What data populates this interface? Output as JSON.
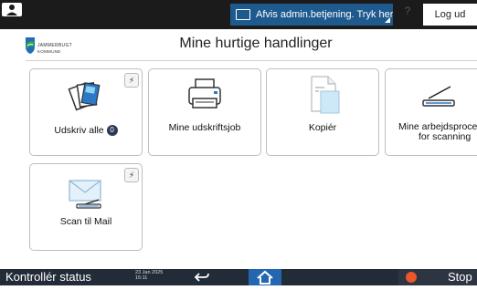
{
  "topbar": {
    "notice_text": "Afvis admin.betjening. Tryk her",
    "help_label": "?",
    "logout_label": "Log ud"
  },
  "header": {
    "logo_line1": "JAMMERBUGT",
    "logo_line2": "KOMMUNE",
    "title": "Mine hurtige handlinger"
  },
  "tiles": [
    {
      "label": "Udskriv alle",
      "badge": "0",
      "flash": "⚡"
    },
    {
      "label": "Mine udskriftsjob"
    },
    {
      "label": "Kopiér"
    },
    {
      "label_line1": "Mine arbejdsprocess",
      "label_line2": "for scanning"
    },
    {
      "label": "Scan til Mail",
      "flash": "⚡"
    }
  ],
  "bottombar": {
    "status_label": "Kontrollér status",
    "date": "23 Jan 2025",
    "time": "15:11",
    "stop_label": "Stop"
  },
  "colors": {
    "topbar": "#1b1b1b",
    "notice": "#1e5a8e",
    "bottombar": "#222b38",
    "home": "#2466b0",
    "stop": "#e9572b"
  }
}
